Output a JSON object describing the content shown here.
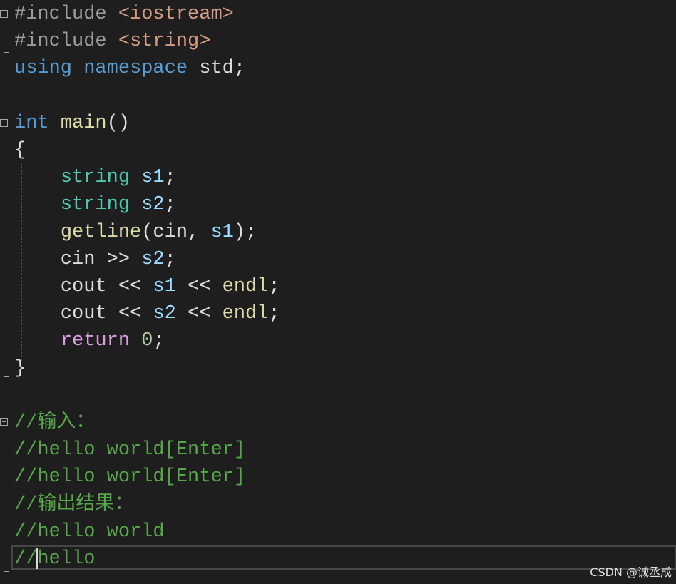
{
  "editor": {
    "theme_colors": {
      "background": "#1e1e1e",
      "preprocessor": "#9b9b9b",
      "string": "#d69d85",
      "keyword": "#569cd6",
      "type": "#4ec9b0",
      "variable": "#9cdcfe",
      "function": "#dcdcaa",
      "control": "#d8a0df",
      "number": "#b5cea8",
      "comment": "#57a64a",
      "text": "#dcdcdc"
    },
    "lines": [
      {
        "tokens": [
          [
            "#include ",
            "c-pp"
          ],
          [
            "<iostream>",
            "c-str"
          ]
        ]
      },
      {
        "tokens": [
          [
            "#include ",
            "c-pp"
          ],
          [
            "<string>",
            "c-str"
          ]
        ]
      },
      {
        "tokens": [
          [
            "using",
            "c-kw"
          ],
          [
            " ",
            "c-txt"
          ],
          [
            "namespace",
            "c-kw"
          ],
          [
            " std;",
            "c-txt"
          ]
        ]
      },
      {
        "tokens": []
      },
      {
        "tokens": [
          [
            "int",
            "c-kw"
          ],
          [
            " ",
            "c-txt"
          ],
          [
            "main",
            "c-fn"
          ],
          [
            "()",
            "c-txt"
          ]
        ]
      },
      {
        "tokens": [
          [
            "{",
            "c-txt"
          ]
        ]
      },
      {
        "tokens": [
          [
            "    ",
            "c-txt"
          ],
          [
            "string",
            "c-type"
          ],
          [
            " ",
            "c-txt"
          ],
          [
            "s1",
            "c-var"
          ],
          [
            ";",
            "c-txt"
          ]
        ]
      },
      {
        "tokens": [
          [
            "    ",
            "c-txt"
          ],
          [
            "string",
            "c-type"
          ],
          [
            " ",
            "c-txt"
          ],
          [
            "s2",
            "c-var"
          ],
          [
            ";",
            "c-txt"
          ]
        ]
      },
      {
        "tokens": [
          [
            "    ",
            "c-txt"
          ],
          [
            "getline",
            "c-fn"
          ],
          [
            "(cin, ",
            "c-txt"
          ],
          [
            "s1",
            "c-var"
          ],
          [
            ");",
            "c-txt"
          ]
        ]
      },
      {
        "tokens": [
          [
            "    cin >> ",
            "c-txt"
          ],
          [
            "s2",
            "c-var"
          ],
          [
            ";",
            "c-txt"
          ]
        ]
      },
      {
        "tokens": [
          [
            "    cout << ",
            "c-txt"
          ],
          [
            "s1",
            "c-var"
          ],
          [
            " << ",
            "c-txt"
          ],
          [
            "endl",
            "c-fn"
          ],
          [
            ";",
            "c-txt"
          ]
        ]
      },
      {
        "tokens": [
          [
            "    cout << ",
            "c-txt"
          ],
          [
            "s2",
            "c-var"
          ],
          [
            " << ",
            "c-txt"
          ],
          [
            "endl",
            "c-fn"
          ],
          [
            ";",
            "c-txt"
          ]
        ]
      },
      {
        "tokens": [
          [
            "    ",
            "c-txt"
          ],
          [
            "return",
            "c-ctrl"
          ],
          [
            " ",
            "c-txt"
          ],
          [
            "0",
            "c-num"
          ],
          [
            ";",
            "c-txt"
          ]
        ]
      },
      {
        "tokens": [
          [
            "}",
            "c-txt"
          ]
        ]
      },
      {
        "tokens": []
      },
      {
        "tokens": [
          [
            "//输入：",
            "c-cmt"
          ]
        ]
      },
      {
        "tokens": [
          [
            "//hello world[Enter]",
            "c-cmt"
          ]
        ]
      },
      {
        "tokens": [
          [
            "//hello world[Enter]",
            "c-cmt"
          ]
        ]
      },
      {
        "tokens": [
          [
            "//输出结果：",
            "c-cmt"
          ]
        ]
      },
      {
        "tokens": [
          [
            "//hello world",
            "c-cmt"
          ]
        ]
      },
      {
        "tokens": [
          [
            "//hello",
            "c-cmt"
          ]
        ]
      }
    ]
  },
  "watermark": "CSDN @诚丞成"
}
